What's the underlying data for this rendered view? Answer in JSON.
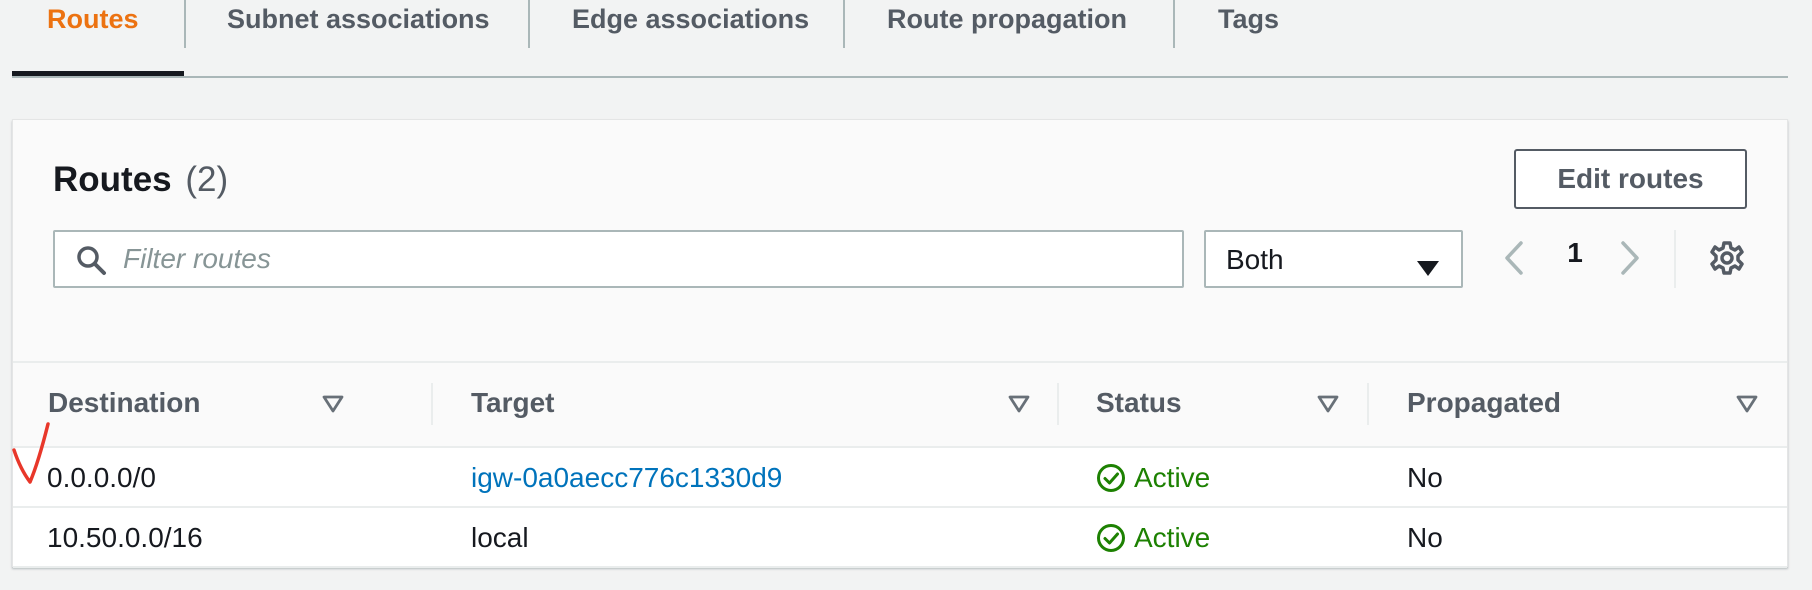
{
  "tabs": [
    {
      "label": "Routes",
      "active": true
    },
    {
      "label": "Subnet associations",
      "active": false
    },
    {
      "label": "Edge associations",
      "active": false
    },
    {
      "label": "Route propagation",
      "active": false
    },
    {
      "label": "Tags",
      "active": false
    }
  ],
  "panel": {
    "title": "Routes",
    "count": "(2)",
    "edit_button": "Edit routes",
    "filter_placeholder": "Filter routes",
    "select_value": "Both",
    "page_number": "1"
  },
  "table": {
    "columns": [
      "Destination",
      "Target",
      "Status",
      "Propagated"
    ],
    "rows": [
      {
        "destination": "0.0.0.0/0",
        "target": "igw-0a0aecc776c1330d9",
        "target_is_link": true,
        "status": "Active",
        "propagated": "No"
      },
      {
        "destination": "10.50.0.0/16",
        "target": "local",
        "target_is_link": false,
        "status": "Active",
        "propagated": "No"
      }
    ]
  },
  "colors": {
    "active_tab": "#ec7211",
    "link": "#0073bb",
    "status_success": "#1d8102",
    "annotation_mark": "#e8372a"
  },
  "icons": [
    "search-icon",
    "caret-down-icon",
    "chevron-left-icon",
    "chevron-right-icon",
    "settings-gear-icon",
    "sort-icon",
    "status-check-icon",
    "annotation-checkmark-icon"
  ]
}
